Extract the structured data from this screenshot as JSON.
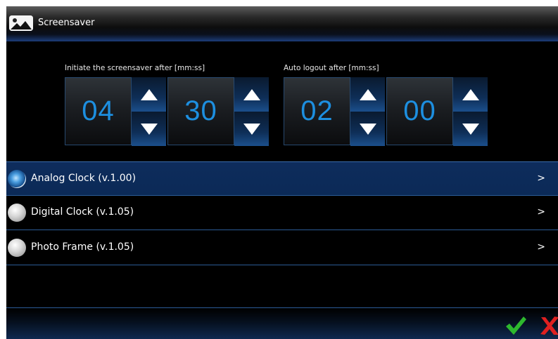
{
  "window": {
    "title": "Screensaver",
    "icon": "picture-icon"
  },
  "screensaver_delay": {
    "label": "Initiate the screensaver after [mm:ss]",
    "minutes": "04",
    "seconds": "30"
  },
  "auto_logout": {
    "label": "Auto logout after [mm:ss]",
    "minutes": "02",
    "seconds": "00"
  },
  "screensavers": [
    {
      "label": "Analog Clock (v.1.00)",
      "selected": true,
      "chevron": ">"
    },
    {
      "label": "Digital Clock (v.1.05)",
      "selected": false,
      "chevron": ">"
    },
    {
      "label": "Photo Frame (v.1.05)",
      "selected": false,
      "chevron": ">"
    }
  ],
  "actions": {
    "ok_icon": "checkmark-icon",
    "cancel_icon": "x-icon"
  },
  "colors": {
    "digit": "#1d8fe0",
    "selected_row": "#0e2c5c",
    "ok": "#2eb82e",
    "cancel": "#e02020"
  }
}
